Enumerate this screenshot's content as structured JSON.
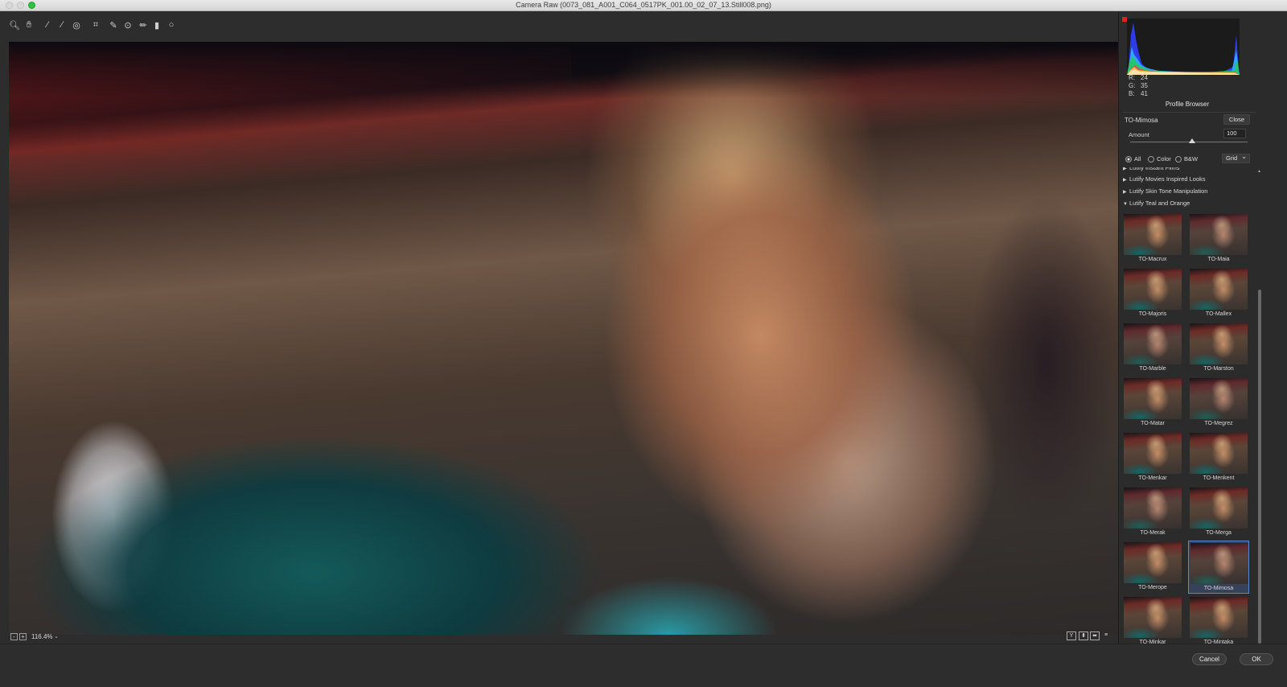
{
  "window": {
    "title": "Camera Raw (0073_081_A001_C064_0517PK_001.00_02_07_13.Still008.png)"
  },
  "toolbar": {
    "tools": [
      {
        "name": "zoom-tool",
        "glyph": "🔍︎"
      },
      {
        "name": "hand-tool",
        "glyph": "✋︎"
      },
      {
        "name": "white-balance-tool",
        "glyph": "⁄"
      },
      {
        "name": "color-sampler-tool",
        "glyph": "⁄"
      },
      {
        "name": "targeted-adjustment-tool",
        "glyph": "◎"
      },
      {
        "name": "crop-tool",
        "glyph": "⌗"
      },
      {
        "name": "spot-removal-tool",
        "glyph": "✎"
      },
      {
        "name": "red-eye-tool",
        "glyph": "⊙"
      },
      {
        "name": "adjustment-brush-tool",
        "glyph": "✏"
      },
      {
        "name": "graduated-filter-tool",
        "glyph": "▮"
      },
      {
        "name": "radial-filter-tool",
        "glyph": "○"
      }
    ]
  },
  "status": {
    "zoom": "116.4%",
    "minus": "-",
    "plus": "+",
    "view_buttons": [
      "Y",
      "⬍",
      "⬌",
      "≡"
    ]
  },
  "panel": {
    "rgb": {
      "r_label": "R:",
      "r": "24",
      "g_label": "G:",
      "g": "35",
      "b_label": "B:",
      "b": "41"
    },
    "title": "Profile Browser",
    "profile_name": "TO-Mimosa",
    "close_label": "Close",
    "amount_label": "Amount",
    "amount_value": "100",
    "amount_fraction": 0.53,
    "filters": {
      "all": "All",
      "color": "Color",
      "bw": "B&W"
    },
    "view_mode": "Grid",
    "groups": [
      {
        "label": "Lutify Instant Films",
        "expanded": false
      },
      {
        "label": "Lutify Movies Inspired Looks",
        "expanded": false
      },
      {
        "label": "Lutify Skin Tone Manipulation",
        "expanded": false
      },
      {
        "label": "Lutify Teal and Orange",
        "expanded": true
      }
    ],
    "thumbs": [
      "TO-Macrux",
      "TO-Maia",
      "TO-Majoris",
      "TO-Mallex",
      "TO-Marble",
      "TO-Marston",
      "TO-Matar",
      "TO-Megrez",
      "TO-Menkar",
      "TO-Menkent",
      "TO-Merak",
      "TO-Merga",
      "TO-Merope",
      "TO-Mimosa",
      "TO-Minkar",
      "TO-Mintaka"
    ],
    "selected_thumb": "TO-Mimosa"
  },
  "footer": {
    "cancel": "Cancel",
    "ok": "OK"
  },
  "colors": {
    "accent_selected": "#5a85c8",
    "histogram_clip": "#e02020"
  }
}
